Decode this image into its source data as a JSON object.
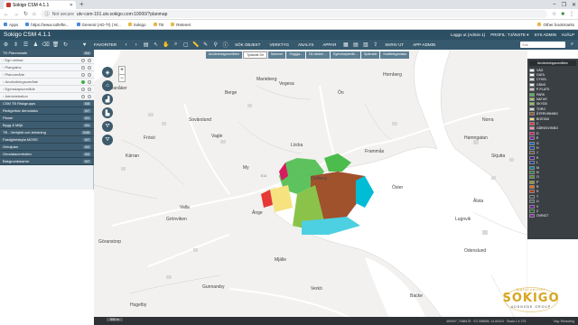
{
  "browser": {
    "tab_title": "Sokigo CSM 4.1.1",
    "new_tab": "+",
    "window_controls": [
      "–",
      "❐",
      "✕"
    ],
    "not_secure": "Not secure",
    "url": "utv-csm-101.utv.sokigo.com:10000/?planmap",
    "bookmarks": [
      "Apps",
      "https://www.sollefte...",
      "General (AD-TI) | M...",
      "Sokigo",
      "TB",
      "Retenet"
    ],
    "other_bookmarks": "Other bookmarks"
  },
  "app": {
    "title": "Sokigo CSM 4.1.1",
    "header_right": [
      "Loggo ut (Admin 1)",
      "PROFIL: TJÄNSTE ▾",
      "SYS ADMIN",
      "HJÄLP"
    ],
    "toolbar_labels": [
      "FAVORITER",
      "SÖK OBJEKT",
      "VERKTYG",
      "ANALYS",
      "APPAR",
      "SKRIV UT",
      "APP-ADMIN"
    ],
    "search_placeholder": "Sök",
    "nav_back": "‹",
    "nav_forward": "›"
  },
  "left_panel": {
    "rows": [
      {
        "label": "TD Planmosaik",
        "count": "0/4",
        "type": "hdr"
      },
      {
        "label": "Egn vertaw",
        "type": "sub"
      },
      {
        "label": "Plangräns",
        "type": "sub"
      },
      {
        "label": "Planområde",
        "type": "sub"
      },
      {
        "label": "Användningsområde",
        "type": "sub",
        "active": true
      },
      {
        "label": "Egenskapsområde",
        "type": "sub"
      },
      {
        "label": "Administration",
        "type": "sub"
      },
      {
        "label": "CSM TB Riskgrupps",
        "count": "0/8",
        "type": "hdr"
      },
      {
        "label": "Redigerbar demodata",
        "count": "0/7",
        "type": "hdr"
      },
      {
        "label": "Planer",
        "count": "0/1",
        "type": "hdr"
      },
      {
        "label": "Bygg & Miljö",
        "count": "0/1",
        "type": "hdr"
      },
      {
        "label": "TB - Verbjekt och belstning",
        "count": "0/45",
        "type": "hdr"
      },
      {
        "label": "Fastighetskyta MOSS",
        "count": "0/7",
        "type": "hdr"
      },
      {
        "label": "Getulplan",
        "count": "0/2",
        "type": "hdr"
      },
      {
        "label": "Geodatacentralen",
        "count": "0/2",
        "type": "hdr"
      },
      {
        "label": "Bakgrundskartor",
        "count": "0/7",
        "type": "hdr"
      }
    ]
  },
  "map": {
    "tabs": [
      "Användningsområden",
      "Tydande Dh",
      "Nummer",
      "Snygga...",
      "Dk värden ...",
      "Egenskapsmån...",
      "Spärrade",
      "Kvalitetsgranska"
    ],
    "active_tab": 1,
    "places": [
      "Berge",
      "Marieberg",
      "Vegesa",
      "Frösö",
      "Vagle",
      "Ön",
      "Löcka",
      "Frammås",
      "Öster",
      "My",
      "Valla",
      "Änge",
      "Grönviken",
      "Sovärslund",
      "Östberg",
      "Hornberg",
      "Norra",
      "Hamngatan",
      "Ovanåker",
      "Skjutta",
      "Ålsta",
      "Verkö",
      "Gunnarsby",
      "Hugelby",
      "Odenslund",
      "Backe",
      "Lugnvik",
      "Kärran",
      "Göranstorp",
      "Mjälle"
    ],
    "road_label": "E14",
    "scale": "500 m",
    "coords_text": "469097, 7088478 · E3 398688, 14.60424 · Skala 1:4 276",
    "status_right": "Väg: Rörastörg"
  },
  "legend": {
    "title": "Användningsområden",
    "items": [
      {
        "label": "VÄG",
        "color": "#ffffff"
      },
      {
        "label": "GATA",
        "color": "#ffffff"
      },
      {
        "label": "CYKEL",
        "color": "#e0e0e0"
      },
      {
        "label": "GÅNG",
        "color": "#f0f0f0"
      },
      {
        "label": "P-PLATS",
        "color": "#c8c8c8"
      },
      {
        "label": "PARK",
        "color": "#4cbc4c"
      },
      {
        "label": "NATUR",
        "color": "#9ccc65"
      },
      {
        "label": "SKYDD",
        "color": "#8bc34a"
      },
      {
        "label": "TORG",
        "color": "#d9d9d9"
      },
      {
        "label": "ÅTERVINNING",
        "color": "#a0522d"
      },
      {
        "label": "BOSTAD",
        "color": "#f6e27f"
      },
      {
        "label": "C",
        "color": "#e53935"
      },
      {
        "label": "GÅRDSVIS/BO",
        "color": "#f48fb1"
      },
      {
        "label": "D",
        "color": "#d81b60"
      },
      {
        "label": "E",
        "color": "#7b1fa2"
      },
      {
        "label": "G",
        "color": "#1565c0"
      },
      {
        "label": "H",
        "color": "#0d47a1"
      },
      {
        "label": "J",
        "color": "#6d4c41"
      },
      {
        "label": "K",
        "color": "#4a148c"
      },
      {
        "label": "L",
        "color": "#283593"
      },
      {
        "label": "M",
        "color": "#00838f"
      },
      {
        "label": "N",
        "color": "#2e7d32"
      },
      {
        "label": "O",
        "color": "#558b2f"
      },
      {
        "label": "P",
        "color": "#9e9d24"
      },
      {
        "label": "R",
        "color": "#ef6c00"
      },
      {
        "label": "S",
        "color": "#bf360c"
      },
      {
        "label": "T",
        "color": "#37474f"
      },
      {
        "label": "U",
        "color": "#455a64"
      },
      {
        "label": "V",
        "color": "#6a1b9a"
      },
      {
        "label": "Z",
        "color": "#1b5e20"
      },
      {
        "label": "ÖVRIGT",
        "color": "#8e24aa"
      }
    ]
  },
  "logo": {
    "tagline": "Naturvernet",
    "name": "SOKIGO",
    "subtitle": "ADDNODE GROUP"
  }
}
